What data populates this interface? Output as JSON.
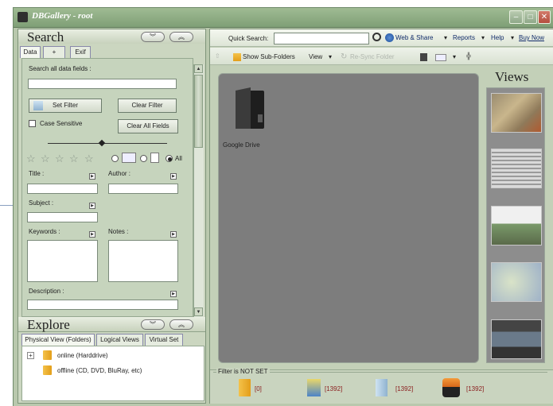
{
  "window": {
    "title": "DBGallery - root"
  },
  "search": {
    "title": "Search",
    "tabs": [
      "Data",
      "+",
      "Exif"
    ],
    "search_all_label": "Search all data fields :",
    "set_filter": "Set Filter",
    "clear_filter": "Clear Filter",
    "case_sensitive": "Case Sensitive",
    "clear_all_fields": "Clear All Fields",
    "rating_all_label": "All",
    "fields": {
      "title": "Title :",
      "author": "Author :",
      "subject": "Subject :",
      "keywords": "Keywords :",
      "notes": "Notes :",
      "description": "Description :"
    }
  },
  "explore": {
    "title": "Explore",
    "tabs": [
      "Physical View (Folders)",
      "Logical Views",
      "Virtual Set"
    ],
    "tree": [
      {
        "label": "online (Harddrive)"
      },
      {
        "label": "offline (CD, DVD, BluRay, etc)"
      }
    ]
  },
  "toolbar": {
    "quick_search_label": "Quick Search:",
    "quick_search_value": "",
    "web_share": "Web & Share",
    "reports": "Reports",
    "help": "Help",
    "buy_now": "Buy Now",
    "show_subfolders": "Show Sub-Folders",
    "view": "View",
    "re_sync": "Re-Sync Folder"
  },
  "gallery": {
    "items": [
      {
        "label": "Google Drive"
      }
    ]
  },
  "views": {
    "title": "Views"
  },
  "filter": {
    "status": "Filter is NOT SET",
    "counts": [
      "[0]",
      "[1392]",
      "[1392]",
      "[1392]"
    ]
  },
  "colors": {
    "accent": "#7f9f76",
    "count_text": "#8a1c1c",
    "gallery_bg": "#7d7d7d"
  }
}
